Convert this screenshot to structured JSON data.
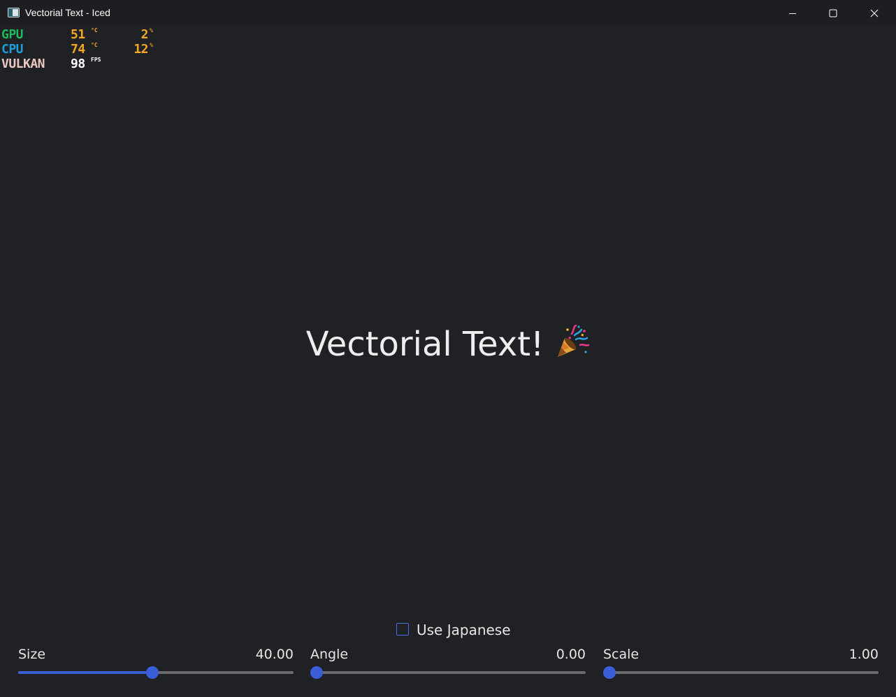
{
  "window": {
    "title": "Vectorial Text - Iced",
    "controls": {
      "minimize_icon": "minimize-icon",
      "maximize_icon": "maximize-icon",
      "close_icon": "close-icon"
    }
  },
  "overlay": {
    "rows": [
      {
        "name": "GPU",
        "value": "51",
        "unit": "°C",
        "value2": "2",
        "unit2": "%",
        "name_color": "#1fb85a",
        "value_color": "#f5a623"
      },
      {
        "name": "CPU",
        "value": "74",
        "unit": "°C",
        "value2": "12",
        "unit2": "%",
        "name_color": "#1a9fd8",
        "value_color": "#f5a623"
      },
      {
        "name": "VULKAN",
        "value": "98",
        "unit": "FPS",
        "value2": "",
        "unit2": "",
        "name_color": "#e9c8c0",
        "value_color": "#ffffff"
      }
    ]
  },
  "main": {
    "text": "Vectorial Text!",
    "emoji_icon": "party-popper-icon"
  },
  "controls": {
    "use_japanese": {
      "label": "Use Japanese",
      "checked": false
    },
    "sliders": [
      {
        "label": "Size",
        "value_text": "40.00",
        "fraction": 0.487
      },
      {
        "label": "Angle",
        "value_text": "0.00",
        "fraction": 0.0
      },
      {
        "label": "Scale",
        "value_text": "1.00",
        "fraction": 0.0
      }
    ]
  },
  "colors": {
    "background": "#202125",
    "accent": "#3a5ed8",
    "track": "#6a6b6f"
  }
}
